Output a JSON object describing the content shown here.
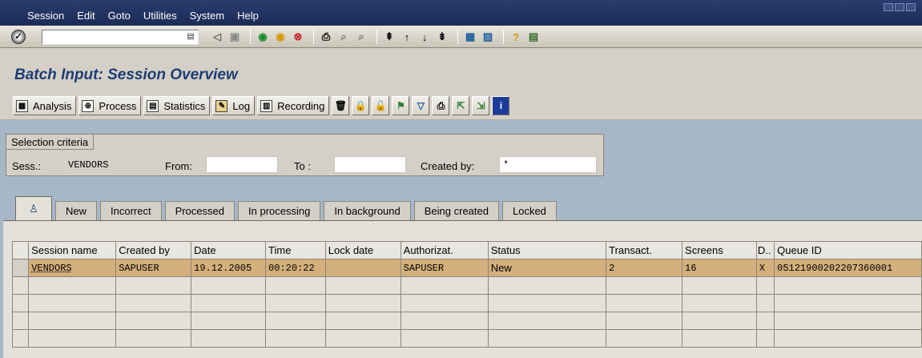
{
  "menubar": {
    "items": [
      "Session",
      "Edit",
      "Goto",
      "Utilities",
      "System",
      "Help"
    ]
  },
  "systoolbar": {
    "command_field_value": "",
    "icons": [
      "enter-icon",
      "back-icon",
      "exit-icon",
      "cancel-icon",
      "print-icon",
      "find-icon",
      "find-next-icon",
      "first-page-icon",
      "previous-page-icon",
      "next-page-icon",
      "last-page-icon",
      "create-session-icon",
      "shortcut-icon",
      "help-icon",
      "layout-icon"
    ]
  },
  "title": "Batch Input: Session Overview",
  "apptoolbar": {
    "analysis": "Analysis",
    "process": "Process",
    "statistics": "Statistics",
    "log": "Log",
    "recording": "Recording"
  },
  "selection": {
    "title": "Selection criteria",
    "sess_label": "Sess.:",
    "sess_value": "VENDORS",
    "from_label": "From:",
    "from_value": "",
    "to_label": "To :",
    "to_value": "",
    "created_by_label": "Created by:",
    "created_by_value": "*"
  },
  "tabs": [
    "New",
    "Incorrect",
    "Processed",
    "In processing",
    "In background",
    "Being created",
    "Locked"
  ],
  "table": {
    "headers": [
      "Session name",
      "Created by",
      "Date",
      "Time",
      "Lock date",
      "Authorizat.",
      "Status",
      "Transact.",
      "Screens",
      "D..",
      "Queue ID"
    ],
    "rows": [
      [
        "VENDORS",
        "SAPUSER",
        "19.12.2005",
        "00:20:22",
        "",
        "SAPUSER",
        "New",
        "2",
        "16",
        "X",
        "05121900202207360001"
      ]
    ]
  },
  "colors": {
    "menubar": "#1b2b57",
    "title": "#1d3c73",
    "workarea": "#a6b7c7",
    "selected_row": "#d3b07c"
  }
}
